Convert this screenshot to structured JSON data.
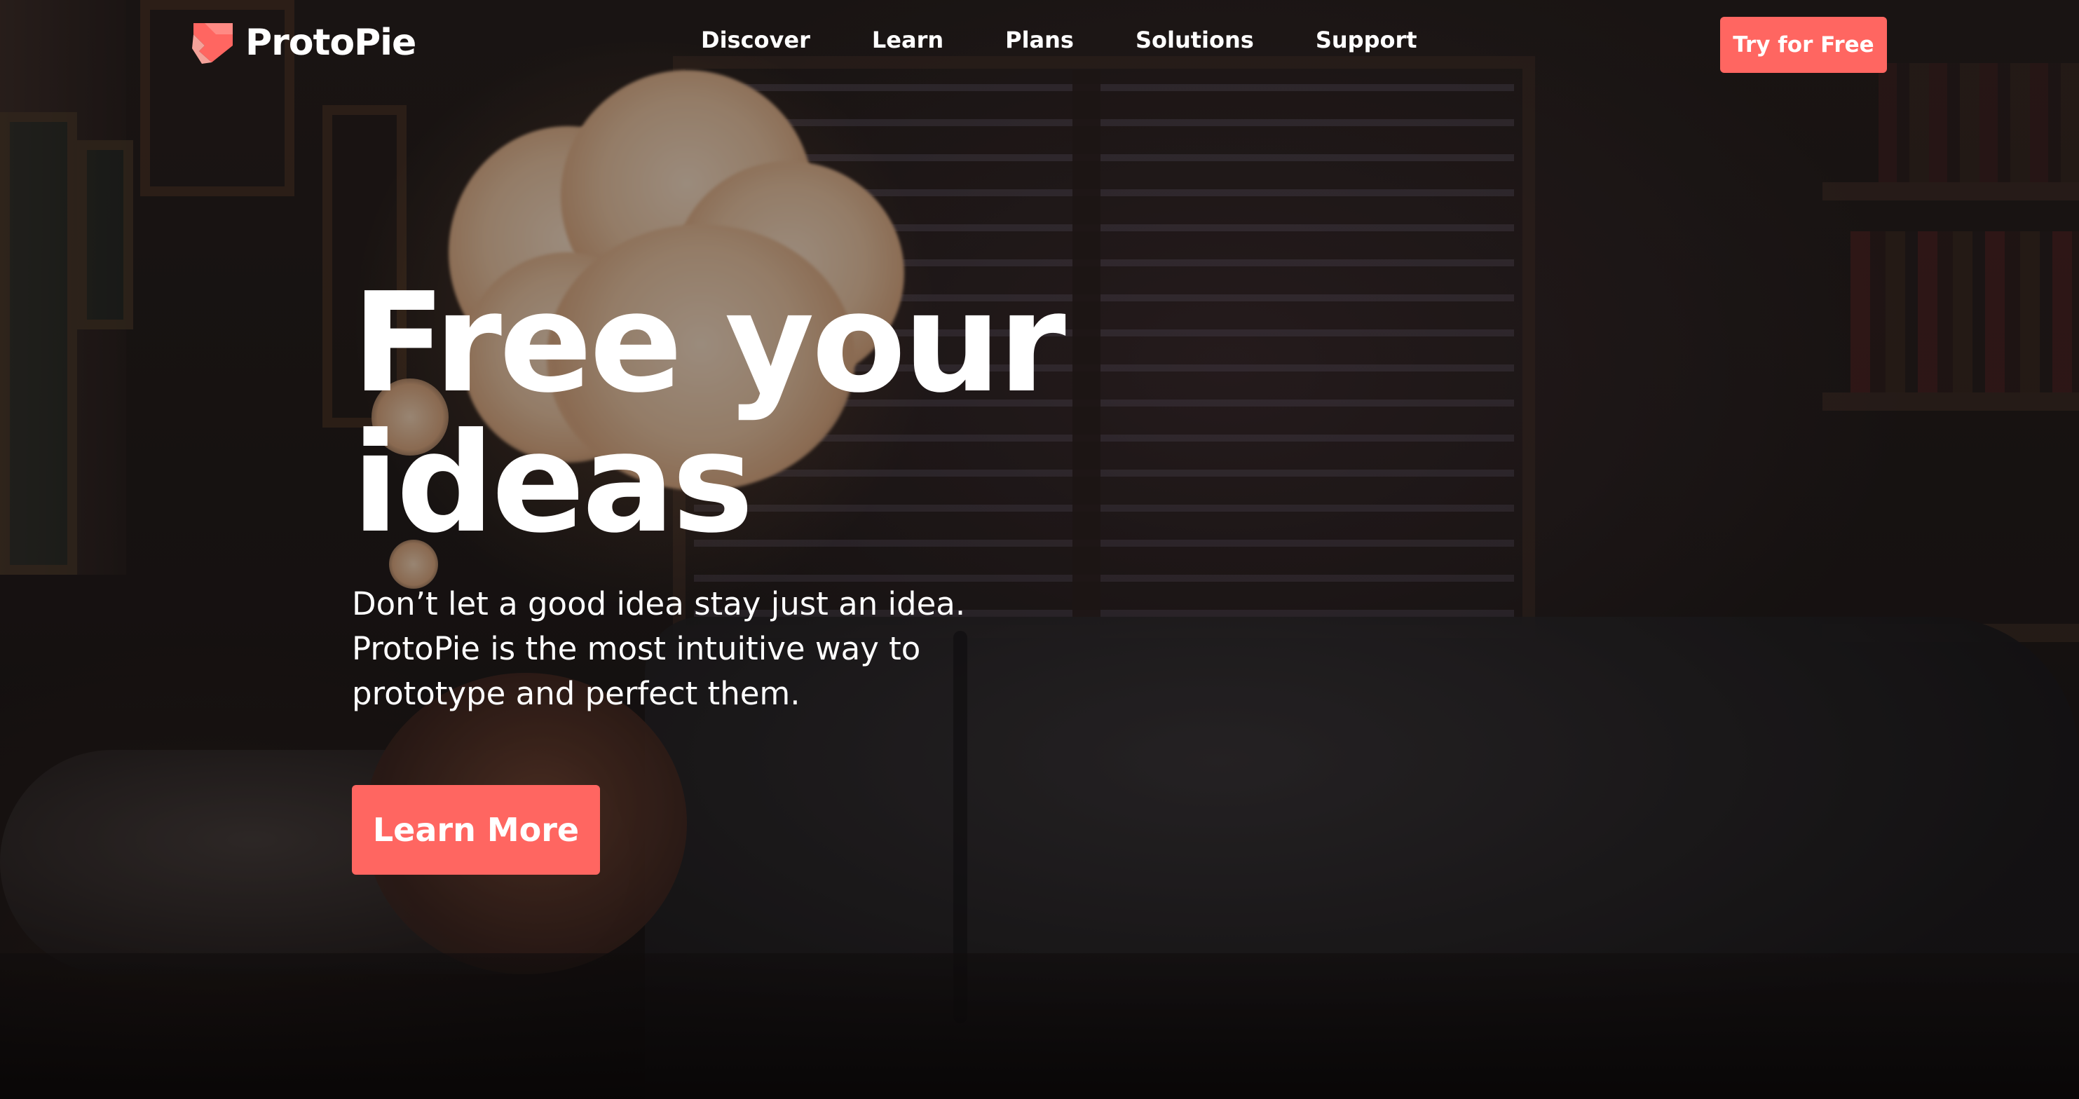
{
  "brand": {
    "name": "ProtoPie",
    "accent_color": "#ff6661",
    "logo_icon": "protopie-logo-icon"
  },
  "nav": {
    "links": [
      "Discover",
      "Learn",
      "Plans",
      "Solutions",
      "Support"
    ],
    "cta_label": "Try for Free"
  },
  "hero": {
    "title_line1": "Free your",
    "title_line2": "ideas",
    "subtitle": "Don’t let a good idea stay just an idea. ProtoPie is the most intuitive way to prototype and perfect them.",
    "cta_label": "Learn More"
  },
  "background": {
    "scene": "dark bedroom with glowing thought cloud"
  }
}
